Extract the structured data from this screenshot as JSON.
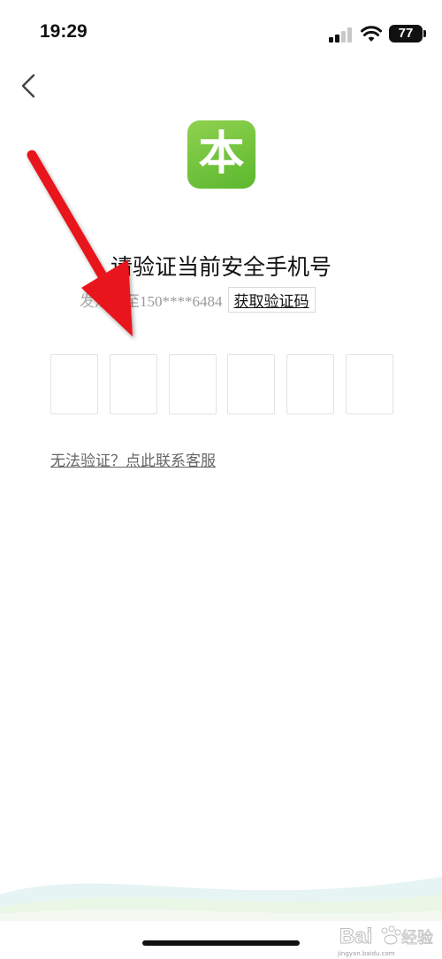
{
  "status_bar": {
    "time": "19:29",
    "battery": "77",
    "signal_icon": "signal-bars-icon",
    "wifi_icon": "wifi-icon"
  },
  "nav": {
    "back_icon": "chevron-left-icon"
  },
  "app": {
    "logo_glyph": "本",
    "logo_color": "#6cc23a"
  },
  "verify": {
    "title": "请验证当前安全手机号",
    "sms_prefix": "发",
    "sms_text": "短信至150****6484",
    "get_code_label": "获取验证码",
    "code_box_count": 6,
    "help_link": "无法验证？点此联系客服"
  },
  "colors": {
    "arrow": "#e8141b",
    "accent_green": "#6cc23a"
  },
  "watermark": {
    "text": "Bai 经验",
    "sub": "jingyan.baidu.com"
  }
}
